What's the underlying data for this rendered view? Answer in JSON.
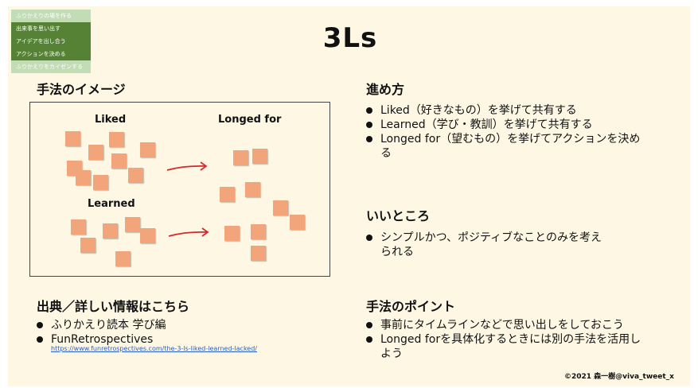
{
  "nav": {
    "items": [
      {
        "label": "ふりかえりの場を作る",
        "active": false
      },
      {
        "label": "出来事を思い出す",
        "active": true
      },
      {
        "label": "アイデアを出し合う",
        "active": true
      },
      {
        "label": "アクションを決める",
        "active": true
      },
      {
        "label": "ふりかえりをカイゼンする",
        "active": false
      }
    ]
  },
  "title": "3Ls",
  "image_section": {
    "heading": "手法のイメージ",
    "labels": {
      "liked": "Liked",
      "longed_for": "Longed for",
      "learned": "Learned"
    }
  },
  "steps": {
    "heading": "進め方",
    "items": [
      "Liked（好きなもの）を挙げて共有する",
      "Learned（学び・教訓）を挙げて共有する",
      "Longed for（望むもの）を挙げてアクションを決める"
    ]
  },
  "good_points": {
    "heading": "いいところ",
    "items": [
      "シンプルかつ、ポジティブなことのみを考えられる"
    ]
  },
  "sources": {
    "heading": "出典／詳しい情報はこちら",
    "items": [
      "ふりかえり読本 学び編",
      "FunRetrospectives"
    ],
    "link": "https://www.funretrospectives.com/the-3-ls-liked-learned-lacked/"
  },
  "tips": {
    "heading": "手法のポイント",
    "items": [
      "事前にタイムラインなどで思い出しをしておこう",
      "Longed forを具体化するときには別の手法を活用しよう"
    ]
  },
  "copyright": "©2021 森一樹@viva_tweet_x",
  "colors": {
    "nav_active": "#568236",
    "nav_inactive": "#c2dcb6",
    "sticky": "#f2a57a",
    "arrow": "#d62a2a",
    "background": "#fdf7e4",
    "link": "#2a5fc2"
  }
}
